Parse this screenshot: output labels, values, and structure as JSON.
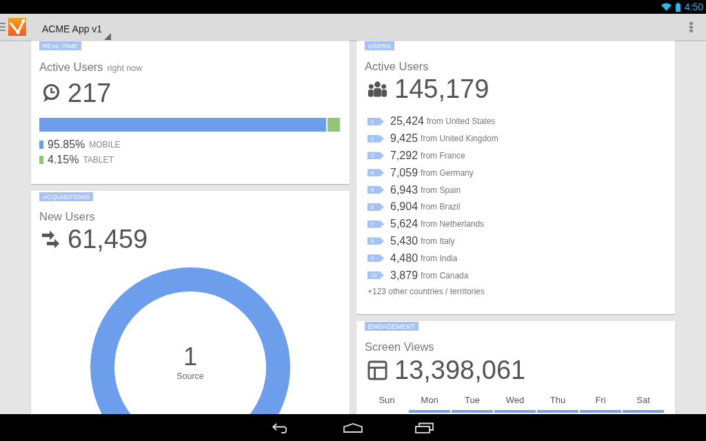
{
  "status_bar": {
    "time": "4:50"
  },
  "action_bar": {
    "title": "ACME App v1"
  },
  "realtime": {
    "tag": "REAL-TIME",
    "title": "Active Users",
    "subtitle": "right now",
    "value": "217",
    "segments": [
      {
        "percent": "95.85%",
        "label": "MOBILE",
        "color": "#6d9eeb",
        "level": 0.9585
      },
      {
        "percent": "4.15%",
        "label": "TABLET",
        "color": "#93c47d"
      }
    ]
  },
  "acquisitions": {
    "tag": "ACQUISITIONS",
    "title": "New Users",
    "value": "61,459",
    "donut": {
      "center_value": "1",
      "center_label": "Source"
    }
  },
  "users": {
    "tag": "USERS",
    "title": "Active Users",
    "value": "145,179",
    "countries": [
      {
        "rank": "1",
        "count": "25,424",
        "text": "from United States"
      },
      {
        "rank": "2",
        "count": "9,425",
        "text": "from United Kingdom"
      },
      {
        "rank": "3",
        "count": "7,292",
        "text": "from France"
      },
      {
        "rank": "4",
        "count": "7,059",
        "text": "from Germany"
      },
      {
        "rank": "5",
        "count": "6,943",
        "text": "from Spain"
      },
      {
        "rank": "6",
        "count": "6,904",
        "text": "from Brazil"
      },
      {
        "rank": "7",
        "count": "5,624",
        "text": "from Netherlands"
      },
      {
        "rank": "8",
        "count": "5,430",
        "text": "from Italy"
      },
      {
        "rank": "9",
        "count": "4,480",
        "text": "from India"
      },
      {
        "rank": "10",
        "count": "3,879",
        "text": "from Canada"
      }
    ],
    "footer": "+123 other countries / territories"
  },
  "engagement": {
    "tag": "ENGAGEMENT",
    "title": "Screen Views",
    "value": "13,398,061",
    "days": [
      {
        "label": "Sun",
        "shaded": false
      },
      {
        "label": "Mon",
        "shaded": true
      },
      {
        "label": "Tue",
        "shaded": true
      },
      {
        "label": "Wed",
        "shaded": true
      },
      {
        "label": "Thu",
        "shaded": true
      },
      {
        "label": "Fri",
        "shaded": true
      },
      {
        "label": "Sat",
        "shaded": true
      }
    ]
  }
}
